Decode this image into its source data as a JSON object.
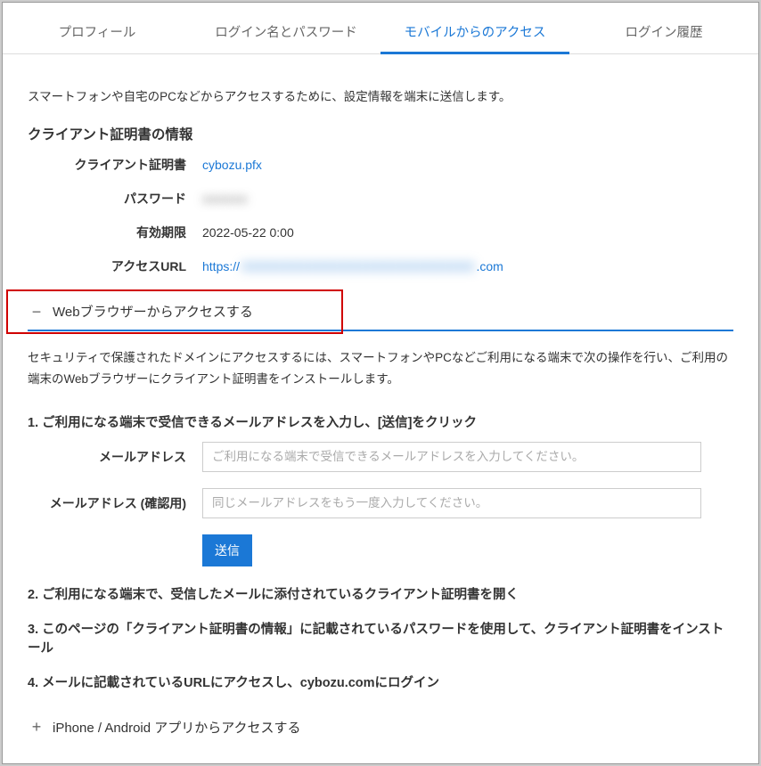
{
  "tabs": [
    {
      "label": "プロフィール"
    },
    {
      "label": "ログイン名とパスワード"
    },
    {
      "label": "モバイルからのアクセス"
    },
    {
      "label": "ログイン履歴"
    }
  ],
  "active_tab": 2,
  "intro": "スマートフォンや自宅のPCなどからアクセスするために、設定情報を端末に送信します。",
  "cert_title": "クライアント証明書の情報",
  "cert": {
    "cert_label": "クライアント証明書",
    "cert_value": "cybozu.pfx",
    "pw_label": "パスワード",
    "pw_value": "●●●●●●",
    "exp_label": "有効期限",
    "exp_value": "2022-05-22 0:00",
    "url_label": "アクセスURL",
    "url_prefix": "https://",
    "url_blurred": "XXXXXXXXXXXXXXXXXXXXXXXXXXXX",
    "url_suffix": ".com"
  },
  "acc1": {
    "icon": "−",
    "title": "Webブラウザーからアクセスする"
  },
  "acc1_desc": "セキュリティで保護されたドメインにアクセスするには、スマートフォンやPCなどご利用になる端末で次の操作を行い、ご利用の端末のWebブラウザーにクライアント証明書をインストールします。",
  "step1": {
    "title": "1. ご利用になる端末で受信できるメールアドレスを入力し、[送信]をクリック",
    "email_label": "メールアドレス",
    "email_ph": "ご利用になる端末で受信できるメールアドレスを入力してください。",
    "confirm_label": "メールアドレス (確認用)",
    "confirm_ph": "同じメールアドレスをもう一度入力してください。",
    "send": "送信"
  },
  "step2": "2. ご利用になる端末で、受信したメールに添付されているクライアント証明書を開く",
  "step3": "3. このページの「クライアント証明書の情報」に記載されているパスワードを使用して、クライアント証明書をインストール",
  "step4": "4. メールに記載されているURLにアクセスし、cybozu.comにログイン",
  "acc2": {
    "icon": "+",
    "title": "iPhone / Android アプリからアクセスする"
  }
}
